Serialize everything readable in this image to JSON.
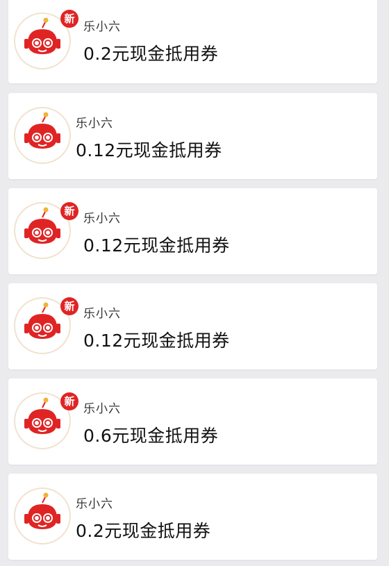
{
  "messages": [
    {
      "sender": "乐小六",
      "badge": "新",
      "title": "0.2元现金抵用券"
    },
    {
      "sender": "乐小六",
      "badge": "",
      "title": "0.12元现金抵用券"
    },
    {
      "sender": "乐小六",
      "badge": "新",
      "title": "0.12元现金抵用券"
    },
    {
      "sender": "乐小六",
      "badge": "新",
      "title": "0.12元现金抵用券"
    },
    {
      "sender": "乐小六",
      "badge": "新",
      "title": "0.6元现金抵用券"
    },
    {
      "sender": "乐小六",
      "badge": "",
      "title": "0.2元现金抵用券"
    }
  ],
  "colors": {
    "badge": "#e02424",
    "avatar_red": "#e02424",
    "avatar_ring": "#f1e2cf",
    "background": "#ebebee"
  },
  "icons": {
    "avatar": "robot-mascot-icon"
  }
}
